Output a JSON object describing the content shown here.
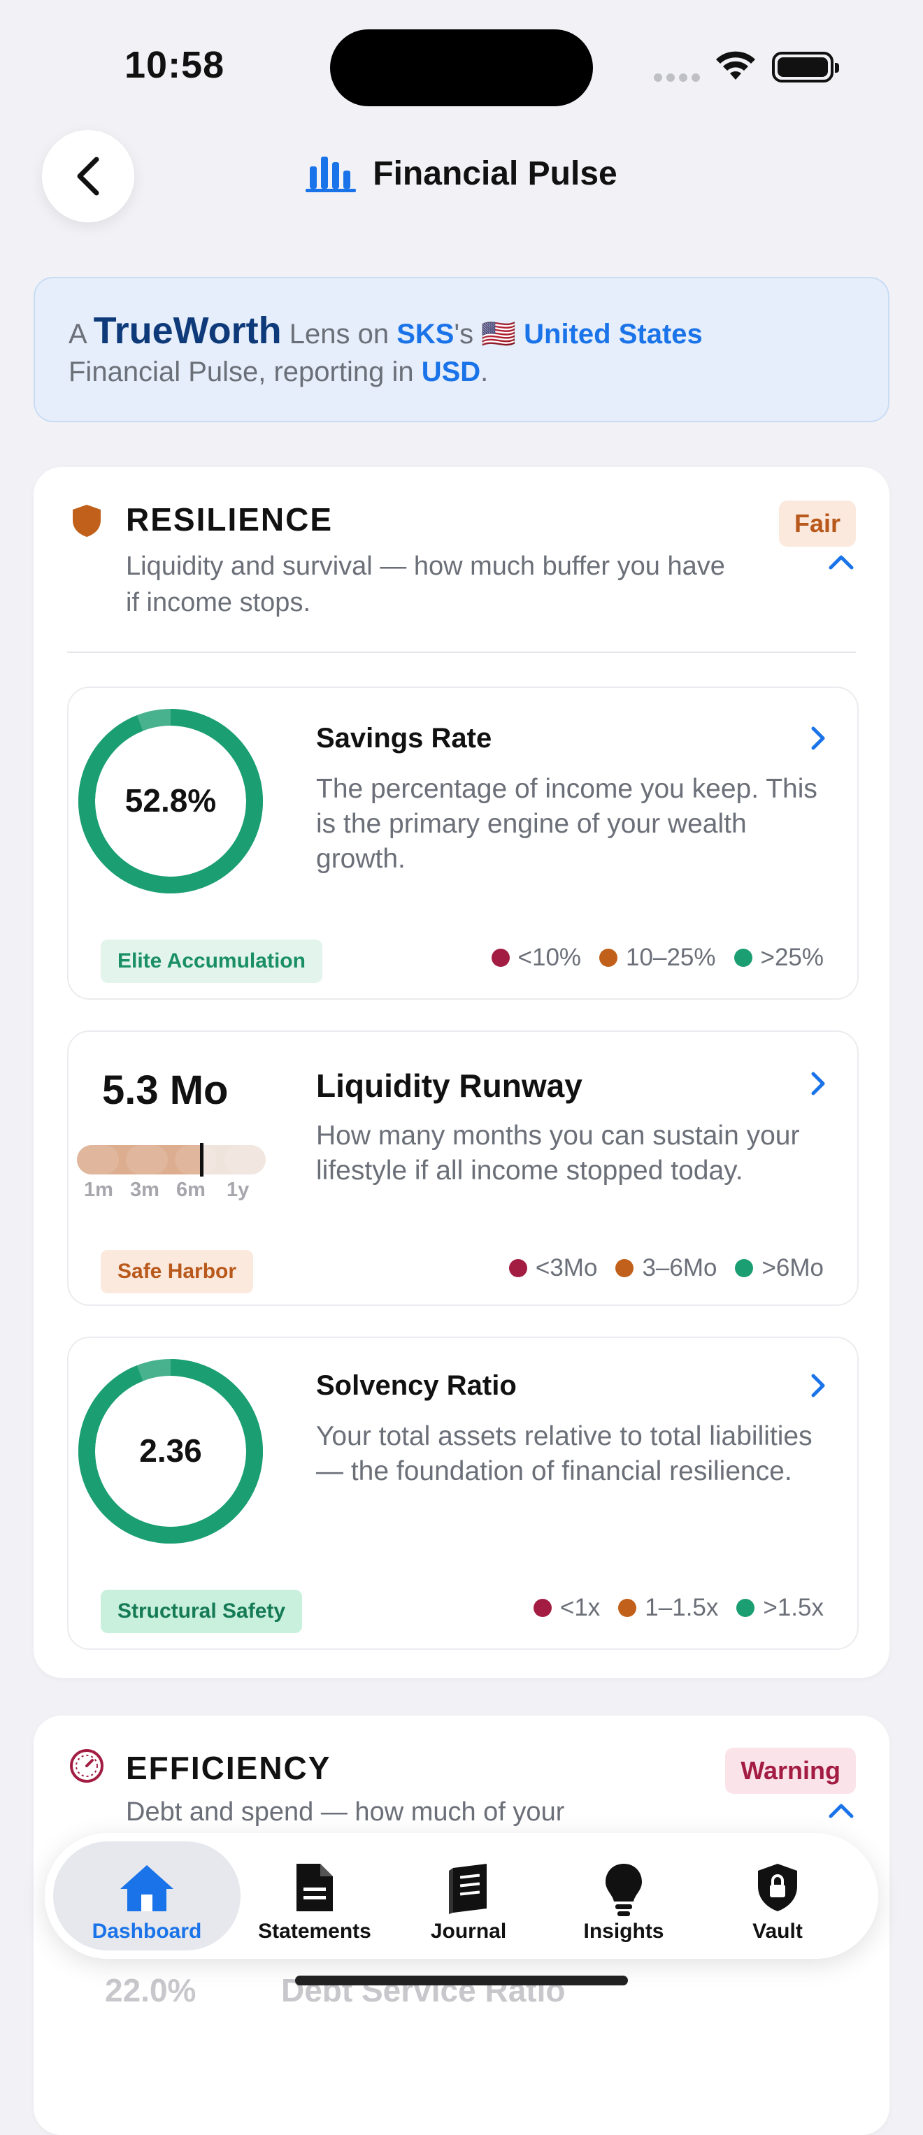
{
  "status_bar": {
    "time": "10:58"
  },
  "header": {
    "title": "Financial Pulse"
  },
  "lens": {
    "a": "A",
    "brand": "TrueWorth",
    "lens_on": "Lens on",
    "user": "SKS",
    "possessive": "'s",
    "flag": "🇺🇸",
    "country": "United States",
    "line2_prefix": "Financial Pulse, reporting in",
    "currency": "USD",
    "line2_suffix": "."
  },
  "resilience": {
    "title": "RESILIENCE",
    "badge": "Fair",
    "description": "Liquidity and survival — how much buffer you have if income stops.",
    "metrics": {
      "savings": {
        "value": "52.8%",
        "progress": 0.94,
        "title": "Savings Rate",
        "description": "The percentage of income you keep. This is the primary engine of your wealth growth.",
        "pill": "Elite Accumulation",
        "legend": [
          "<10%",
          "10–25%",
          ">25%"
        ]
      },
      "runway": {
        "value": "5.3 Mo",
        "fill_fraction": 0.66,
        "ticks": [
          "1m",
          "3m",
          "6m",
          "1y"
        ],
        "title": "Liquidity Runway",
        "description": "How many months you can sustain your lifestyle if all income stopped today.",
        "pill": "Safe Harbor",
        "legend": [
          "<3Mo",
          "3–6Mo",
          ">6Mo"
        ]
      },
      "solvency": {
        "value": "2.36",
        "progress": 0.94,
        "title": "Solvency Ratio",
        "description": "Your total assets relative to total liabilities — the foundation of financial resilience.",
        "pill": "Structural Safety",
        "legend": [
          "<1x",
          "1–1.5x",
          ">1.5x"
        ]
      }
    }
  },
  "efficiency": {
    "title": "EFFICIENCY",
    "badge": "Warning",
    "description": "Debt and spend — how much of your",
    "peek_value": "22.0%",
    "peek_title": "Debt Service Ratio"
  },
  "tabs": [
    {
      "label": "Dashboard"
    },
    {
      "label": "Statements"
    },
    {
      "label": "Journal"
    },
    {
      "label": "Insights"
    },
    {
      "label": "Vault"
    }
  ],
  "colors": {
    "accent": "#1a73e8",
    "green": "#1a9e72",
    "orange": "#c0601a",
    "crimson": "#a31d43"
  }
}
